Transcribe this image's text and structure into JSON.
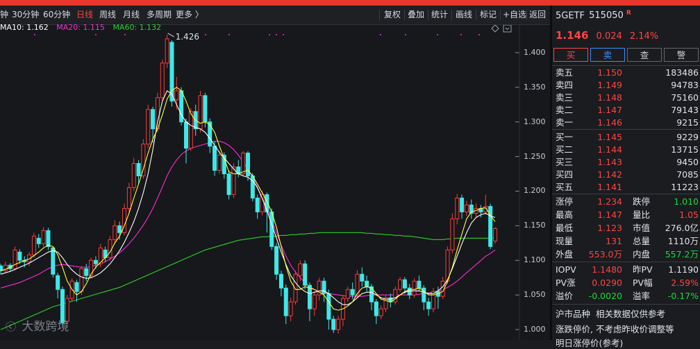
{
  "toolbar": {
    "periods": [
      {
        "label": "钟",
        "active": false
      },
      {
        "label": "30分钟",
        "active": false
      },
      {
        "label": "60分钟",
        "active": false
      },
      {
        "label": "日线",
        "active": true
      },
      {
        "label": "周线",
        "active": false
      },
      {
        "label": "月线",
        "active": false
      },
      {
        "label": "多周期",
        "active": false
      },
      {
        "label": "更多 〉",
        "active": false
      }
    ],
    "actions": [
      "复权",
      "叠加",
      "统计",
      "画线",
      "标记",
      "+自选",
      "返回"
    ]
  },
  "ma_legend": [
    {
      "label": "MA10: 1.162",
      "color": "#ffffff"
    },
    {
      "label": "MA20: 1.115",
      "color": "#ff2bd6"
    },
    {
      "label": "MA60: 1.132",
      "color": "#2fd12f"
    }
  ],
  "chart_data": {
    "type": "candlestick",
    "ylim": [
      0.985,
      1.44
    ],
    "yticks": [
      "1.400",
      "1.350",
      "1.300",
      "1.250",
      "1.200",
      "1.150",
      "1.100",
      "1.050",
      "1.000"
    ],
    "ytick_values": [
      1.4,
      1.35,
      1.3,
      1.25,
      1.2,
      1.15,
      1.1,
      1.05,
      1.0
    ],
    "max_annotation": "1.426",
    "max_index": 35,
    "colors": {
      "up": "#ff3b3b",
      "down": "#3fe8e8",
      "ma10": "#ffffff",
      "ma20": "#ff2bd6",
      "ma60": "#2fd12f",
      "ma5": "#ffff3a"
    },
    "candles": [
      [
        1.092,
        1.085,
        1.095,
        1.08
      ],
      [
        1.085,
        1.093,
        1.098,
        1.082
      ],
      [
        1.093,
        1.088,
        1.096,
        1.084
      ],
      [
        1.088,
        1.115,
        1.12,
        1.085
      ],
      [
        1.112,
        1.1,
        1.116,
        1.095
      ],
      [
        1.1,
        1.098,
        1.106,
        1.09
      ],
      [
        1.098,
        1.108,
        1.112,
        1.092
      ],
      [
        1.108,
        1.135,
        1.14,
        1.104
      ],
      [
        1.132,
        1.124,
        1.138,
        1.118
      ],
      [
        1.124,
        1.143,
        1.148,
        1.12
      ],
      [
        1.143,
        1.12,
        1.147,
        1.115
      ],
      [
        1.118,
        1.08,
        1.12,
        1.075
      ],
      [
        1.078,
        1.058,
        1.082,
        1.045
      ],
      [
        1.058,
        1.01,
        1.062,
        1.005
      ],
      [
        1.012,
        1.045,
        1.05,
        1.008
      ],
      [
        1.045,
        1.07,
        1.074,
        1.04
      ],
      [
        1.068,
        1.055,
        1.072,
        1.04
      ],
      [
        1.055,
        1.088,
        1.092,
        1.05
      ],
      [
        1.088,
        1.078,
        1.095,
        1.07
      ],
      [
        1.078,
        1.1,
        1.104,
        1.074
      ],
      [
        1.1,
        1.095,
        1.106,
        1.088
      ],
      [
        1.095,
        1.118,
        1.124,
        1.09
      ],
      [
        1.115,
        1.104,
        1.12,
        1.098
      ],
      [
        1.104,
        1.13,
        1.135,
        1.1
      ],
      [
        1.13,
        1.15,
        1.158,
        1.125
      ],
      [
        1.15,
        1.14,
        1.156,
        1.13
      ],
      [
        1.14,
        1.175,
        1.182,
        1.136
      ],
      [
        1.175,
        1.205,
        1.212,
        1.17
      ],
      [
        1.205,
        1.24,
        1.248,
        1.2
      ],
      [
        1.24,
        1.222,
        1.245,
        1.21
      ],
      [
        1.222,
        1.268,
        1.275,
        1.218
      ],
      [
        1.268,
        1.318,
        1.325,
        1.262
      ],
      [
        1.318,
        1.29,
        1.322,
        1.27
      ],
      [
        1.29,
        1.335,
        1.342,
        1.285
      ],
      [
        1.335,
        1.385,
        1.39,
        1.33
      ],
      [
        1.385,
        1.42,
        1.426,
        1.378
      ],
      [
        1.415,
        1.33,
        1.418,
        1.322
      ],
      [
        1.332,
        1.345,
        1.365,
        1.318
      ],
      [
        1.345,
        1.3,
        1.35,
        1.295
      ],
      [
        1.3,
        1.262,
        1.305,
        1.24
      ],
      [
        1.262,
        1.315,
        1.32,
        1.258
      ],
      [
        1.315,
        1.29,
        1.325,
        1.28
      ],
      [
        1.29,
        1.338,
        1.345,
        1.285
      ],
      [
        1.338,
        1.3,
        1.342,
        1.292
      ],
      [
        1.3,
        1.265,
        1.305,
        1.255
      ],
      [
        1.265,
        1.23,
        1.272,
        1.222
      ],
      [
        1.23,
        1.252,
        1.258,
        1.225
      ],
      [
        1.252,
        1.225,
        1.256,
        1.218
      ],
      [
        1.225,
        1.195,
        1.23,
        1.188
      ],
      [
        1.195,
        1.235,
        1.24,
        1.19
      ],
      [
        1.235,
        1.225,
        1.245,
        1.22
      ],
      [
        1.225,
        1.255,
        1.258,
        1.222
      ],
      [
        1.255,
        1.222,
        1.258,
        1.215
      ],
      [
        1.222,
        1.19,
        1.226,
        1.185
      ],
      [
        1.19,
        1.17,
        1.195,
        1.16
      ],
      [
        1.17,
        1.195,
        1.2,
        1.165
      ],
      [
        1.195,
        1.17,
        1.198,
        1.14
      ],
      [
        1.17,
        1.12,
        1.175,
        1.115
      ],
      [
        1.12,
        1.08,
        1.125,
        1.072
      ],
      [
        1.08,
        1.06,
        1.085,
        1.048
      ],
      [
        1.06,
        1.02,
        1.065,
        1.008
      ],
      [
        1.02,
        1.04,
        1.046,
        1.012
      ],
      [
        1.04,
        1.08,
        1.085,
        1.036
      ],
      [
        1.078,
        1.095,
        1.1,
        1.07
      ],
      [
        1.095,
        1.064,
        1.1,
        1.058
      ],
      [
        1.064,
        1.03,
        1.068,
        1.012
      ],
      [
        1.03,
        1.05,
        1.055,
        1.02
      ],
      [
        1.05,
        1.07,
        1.075,
        1.042
      ],
      [
        1.07,
        1.052,
        1.075,
        1.04
      ],
      [
        1.052,
        1.015,
        1.058,
        1.0
      ],
      [
        1.015,
        1.0,
        1.02,
        0.995
      ],
      [
        1.0,
        1.015,
        1.02,
        0.994
      ],
      [
        1.015,
        1.045,
        1.05,
        1.005
      ],
      [
        1.045,
        1.058,
        1.062,
        1.04
      ],
      [
        1.058,
        1.05,
        1.068,
        1.044
      ],
      [
        1.05,
        1.08,
        1.086,
        1.045
      ],
      [
        1.08,
        1.07,
        1.09,
        1.062
      ],
      [
        1.07,
        1.062,
        1.078,
        1.055
      ],
      [
        1.062,
        1.04,
        1.066,
        1.028
      ],
      [
        1.04,
        1.02,
        1.044,
        1.008
      ],
      [
        1.02,
        1.03,
        1.035,
        1.015
      ],
      [
        1.03,
        1.046,
        1.05,
        1.025
      ],
      [
        1.046,
        1.04,
        1.052,
        1.032
      ],
      [
        1.04,
        1.058,
        1.062,
        1.036
      ],
      [
        1.058,
        1.072,
        1.076,
        1.054
      ],
      [
        1.072,
        1.06,
        1.076,
        1.052
      ],
      [
        1.06,
        1.05,
        1.066,
        1.044
      ],
      [
        1.05,
        1.07,
        1.074,
        1.046
      ],
      [
        1.07,
        1.06,
        1.078,
        1.055
      ],
      [
        1.06,
        1.04,
        1.064,
        1.028
      ],
      [
        1.04,
        1.03,
        1.046,
        1.02
      ],
      [
        1.03,
        1.055,
        1.06,
        1.025
      ],
      [
        1.055,
        1.048,
        1.062,
        1.03
      ],
      [
        1.048,
        1.07,
        1.076,
        1.044
      ],
      [
        1.07,
        1.115,
        1.12,
        1.066
      ],
      [
        1.115,
        1.16,
        1.168,
        1.11
      ],
      [
        1.16,
        1.19,
        1.196,
        1.152
      ],
      [
        1.19,
        1.17,
        1.195,
        1.16
      ],
      [
        1.17,
        1.18,
        1.186,
        1.164
      ],
      [
        1.18,
        1.168,
        1.188,
        1.16
      ],
      [
        1.168,
        1.175,
        1.182,
        1.162
      ],
      [
        1.175,
        1.17,
        1.18,
        1.162
      ],
      [
        1.17,
        1.178,
        1.195,
        1.166
      ],
      [
        1.178,
        1.12,
        1.182,
        1.116
      ],
      [
        1.128,
        1.146,
        1.148,
        1.124
      ]
    ],
    "ma5": [
      1.085,
      1.087,
      1.09,
      1.094,
      1.097,
      1.1,
      1.102,
      1.107,
      1.112,
      1.118,
      1.122,
      1.12,
      1.108,
      1.09,
      1.07,
      1.058,
      1.05,
      1.055,
      1.066,
      1.08,
      1.09,
      1.097,
      1.104,
      1.112,
      1.125,
      1.135,
      1.15,
      1.168,
      1.19,
      1.21,
      1.232,
      1.255,
      1.275,
      1.29,
      1.31,
      1.333,
      1.345,
      1.35,
      1.345,
      1.33,
      1.312,
      1.302,
      1.298,
      1.3,
      1.296,
      1.285,
      1.265,
      1.247,
      1.228,
      1.225,
      1.225,
      1.228,
      1.23,
      1.222,
      1.21,
      1.198,
      1.185,
      1.17,
      1.148,
      1.12,
      1.092,
      1.07,
      1.058,
      1.058,
      1.062,
      1.06,
      1.058,
      1.054,
      1.05,
      1.04,
      1.03,
      1.028,
      1.03,
      1.034,
      1.04,
      1.052,
      1.06,
      1.062,
      1.06,
      1.052,
      1.044,
      1.042,
      1.04,
      1.044,
      1.05,
      1.055,
      1.058,
      1.058,
      1.06,
      1.056,
      1.05,
      1.05,
      1.052,
      1.055,
      1.07,
      1.09,
      1.115,
      1.138,
      1.16,
      1.17,
      1.172,
      1.175,
      1.176,
      1.165,
      1.156
    ],
    "ma10": [
      1.08,
      1.082,
      1.084,
      1.087,
      1.09,
      1.093,
      1.096,
      1.1,
      1.104,
      1.108,
      1.112,
      1.114,
      1.112,
      1.104,
      1.094,
      1.086,
      1.08,
      1.076,
      1.074,
      1.075,
      1.078,
      1.082,
      1.088,
      1.095,
      1.104,
      1.114,
      1.126,
      1.14,
      1.156,
      1.175,
      1.198,
      1.225,
      1.26,
      1.3,
      1.33,
      1.345,
      1.34,
      1.325,
      1.31,
      1.3,
      1.295,
      1.292,
      1.29,
      1.285,
      1.276,
      1.266,
      1.256,
      1.248,
      1.24,
      1.232,
      1.225,
      1.222,
      1.22,
      1.215,
      1.205,
      1.19,
      1.172,
      1.152,
      1.132,
      1.112,
      1.094,
      1.078,
      1.068,
      1.06,
      1.055,
      1.052,
      1.054,
      1.056,
      1.056,
      1.052,
      1.046,
      1.04,
      1.036,
      1.036,
      1.04,
      1.046,
      1.052,
      1.054,
      1.054,
      1.05,
      1.046,
      1.044,
      1.044,
      1.046,
      1.05,
      1.054,
      1.056,
      1.056,
      1.056,
      1.054,
      1.052,
      1.052,
      1.056,
      1.062,
      1.072,
      1.088,
      1.106,
      1.124,
      1.14,
      1.154,
      1.162,
      1.166,
      1.168,
      1.164,
      1.162
    ],
    "ma20": [
      1.06,
      1.062,
      1.064,
      1.066,
      1.068,
      1.071,
      1.074,
      1.077,
      1.08,
      1.084,
      1.088,
      1.091,
      1.093,
      1.094,
      1.093,
      1.092,
      1.091,
      1.09,
      1.09,
      1.091,
      1.093,
      1.095,
      1.098,
      1.102,
      1.106,
      1.111,
      1.117,
      1.124,
      1.132,
      1.141,
      1.151,
      1.162,
      1.175,
      1.19,
      1.206,
      1.222,
      1.235,
      1.245,
      1.253,
      1.258,
      1.262,
      1.264,
      1.266,
      1.268,
      1.27,
      1.272,
      1.272,
      1.27,
      1.266,
      1.26,
      1.252,
      1.242,
      1.232,
      1.22,
      1.206,
      1.19,
      1.175,
      1.158,
      1.14,
      1.122,
      1.106,
      1.093,
      1.083,
      1.075,
      1.068,
      1.062,
      1.058,
      1.055,
      1.053,
      1.052,
      1.051,
      1.05,
      1.049,
      1.048,
      1.048,
      1.048,
      1.048,
      1.049,
      1.05,
      1.05,
      1.05,
      1.05,
      1.05,
      1.05,
      1.05,
      1.05,
      1.05,
      1.05,
      1.051,
      1.052,
      1.053,
      1.054,
      1.056,
      1.058,
      1.061,
      1.065,
      1.07,
      1.076,
      1.082,
      1.088,
      1.094,
      1.1,
      1.106,
      1.11,
      1.115
    ],
    "ma60": [
      1.0,
      1.003,
      1.006,
      1.009,
      1.012,
      1.015,
      1.018,
      1.021,
      1.024,
      1.027,
      1.03,
      1.033,
      1.035,
      1.037,
      1.039,
      1.041,
      1.043,
      1.045,
      1.047,
      1.049,
      1.051,
      1.053,
      1.055,
      1.057,
      1.059,
      1.061,
      1.064,
      1.067,
      1.07,
      1.073,
      1.076,
      1.079,
      1.082,
      1.085,
      1.088,
      1.091,
      1.094,
      1.097,
      1.1,
      1.103,
      1.106,
      1.109,
      1.112,
      1.115,
      1.117,
      1.119,
      1.121,
      1.123,
      1.125,
      1.127,
      1.129,
      1.13,
      1.131,
      1.132,
      1.133,
      1.134,
      1.134,
      1.135,
      1.135,
      1.136,
      1.136,
      1.137,
      1.137,
      1.138,
      1.138,
      1.139,
      1.139,
      1.14,
      1.14,
      1.14,
      1.14,
      1.14,
      1.14,
      1.14,
      1.14,
      1.14,
      1.14,
      1.139,
      1.139,
      1.138,
      1.138,
      1.137,
      1.137,
      1.136,
      1.136,
      1.135,
      1.135,
      1.134,
      1.133,
      1.132,
      1.131,
      1.13,
      1.13,
      1.13,
      1.131,
      1.131,
      1.132,
      1.132,
      1.132,
      1.132,
      1.132,
      1.132,
      1.132,
      1.132,
      1.132
    ]
  },
  "panel": {
    "code": "5GETF",
    "number": "515050",
    "badge": "R",
    "price": "1.146",
    "change": "0.024",
    "pct": "2.14%",
    "buttons": [
      {
        "label": "买",
        "color": "#ff4545",
        "border": "#ff4545"
      },
      {
        "label": "卖",
        "color": "#3f8cff",
        "border": "#3f8cff"
      },
      {
        "label": "查",
        "color": "#d0d3d8",
        "border": "#666"
      },
      {
        "label": "警",
        "color": "#d0d3d8",
        "border": "#666"
      }
    ],
    "asks": [
      {
        "label": "卖五",
        "price": "1.150",
        "vol": "183486"
      },
      {
        "label": "卖四",
        "price": "1.149",
        "vol": "94783"
      },
      {
        "label": "卖三",
        "price": "1.148",
        "vol": "75160"
      },
      {
        "label": "卖二",
        "price": "1.147",
        "vol": "79143"
      },
      {
        "label": "卖一",
        "price": "1.146",
        "vol": "9215"
      }
    ],
    "bids": [
      {
        "label": "买一",
        "price": "1.145",
        "vol": "9229"
      },
      {
        "label": "买二",
        "price": "1.144",
        "vol": "13715"
      },
      {
        "label": "买三",
        "price": "1.143",
        "vol": "9450"
      },
      {
        "label": "买四",
        "price": "1.142",
        "vol": "7085"
      },
      {
        "label": "买五",
        "price": "1.141",
        "vol": "11223"
      }
    ],
    "stats": [
      {
        "l1": "涨停",
        "v1": "1.234",
        "c1": "up",
        "l2": "跌停",
        "v2": "1.010",
        "c2": "down"
      },
      {
        "l1": "最高",
        "v1": "1.147",
        "c1": "up",
        "l2": "量比",
        "v2": "1.05",
        "c2": "up"
      },
      {
        "l1": "最低",
        "v1": "1.123",
        "c1": "up",
        "l2": "市值",
        "v2": "276.0亿",
        "c2": "wht"
      },
      {
        "l1": "现量",
        "v1": "131",
        "c1": "up",
        "l2": "总量",
        "v2": "1110万",
        "c2": "wht"
      },
      {
        "l1": "外盘",
        "v1": "553.0万",
        "c1": "up",
        "l2": "内盘",
        "v2": "557.2万",
        "c2": "down"
      }
    ],
    "stats2": [
      {
        "l1": "IOPV",
        "v1": "1.1480",
        "c1": "up",
        "l2": "昨PV",
        "v2": "1.1190",
        "c2": "wht"
      },
      {
        "l1": "PV涨",
        "v1": "0.0290",
        "c1": "up",
        "l2": "PV幅",
        "v2": "2.59%",
        "c2": "up"
      },
      {
        "l1": "溢价",
        "v1": "-0.0020",
        "c1": "down",
        "l2": "溢率",
        "v2": "-0.17%",
        "c2": "down"
      }
    ],
    "notice_title": "沪市品种  相关数据仅供参考",
    "notice_line1": "涨跌停价, 不考虑昨收价调整等",
    "notice_line2": "明日涨停价(参考)"
  },
  "watermark": "大数跨境"
}
